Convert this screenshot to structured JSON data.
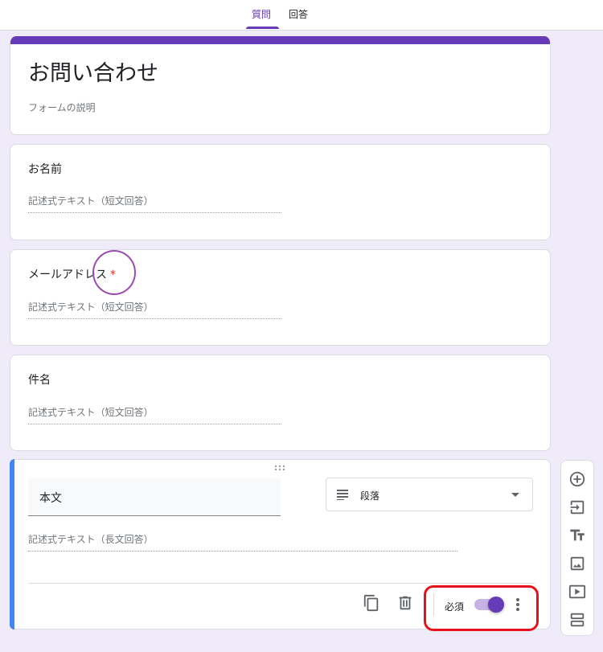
{
  "tabs": {
    "questions": "質問",
    "responses": "回答"
  },
  "form": {
    "title": "お問い合わせ",
    "description": "フォームの説明"
  },
  "questions": [
    {
      "title": "お名前",
      "hint": "記述式テキスト（短文回答）",
      "required": false
    },
    {
      "title": "メールアドレス",
      "hint": "記述式テキスト（短文回答）",
      "required": true,
      "required_mark": "*"
    },
    {
      "title": "件名",
      "hint": "記述式テキスト（短文回答）",
      "required": false
    }
  ],
  "active_question": {
    "title": "本文",
    "type_label": "段落",
    "hint": "記述式テキスト（長文回答）",
    "required_label": "必須",
    "required_on": true
  },
  "icons": {
    "drag": "drag-handle-icon",
    "type": "paragraph-lines-icon",
    "duplicate": "copy-icon",
    "delete": "trash-icon",
    "more": "more-vert-icon",
    "toolbar": [
      "add-circle-icon",
      "import-icon",
      "title-text-icon",
      "image-icon",
      "video-icon",
      "section-icon"
    ]
  },
  "colors": {
    "accent": "#673ab7",
    "background": "#f0ebf8",
    "active_indicator": "#4285f4",
    "required": "#d93025",
    "annotation_circle": "#9c4ab0",
    "annotation_rect": "#e8101a"
  }
}
